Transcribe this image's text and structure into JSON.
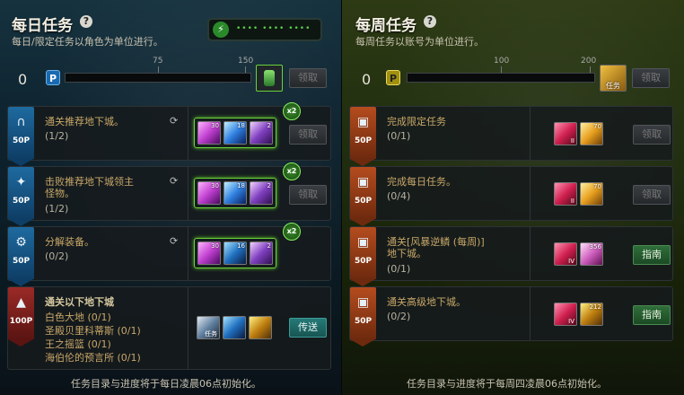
{
  "daily": {
    "title": "每日任务",
    "help": "?",
    "subtitle": "每日/限定任务以角色为单位进行。",
    "points": "0",
    "point_badge": "P",
    "ticks": [
      "75",
      "150"
    ],
    "progress": 0,
    "claim_label": "领取",
    "footer": "任务目录与进度将于每日凌晨06点初始化。",
    "battery_dots": "•••• •••• ••••",
    "tasks": [
      {
        "name": "通关推荐地下城。",
        "progress": "(1/2)",
        "points": "50P",
        "icon": "∩",
        "button": "领取",
        "items": [
          "30",
          "18",
          "2"
        ],
        "bonus": "x2"
      },
      {
        "name": "击败推荐地下城领主怪物。",
        "progress": "(1/2)",
        "points": "50P",
        "icon": "✦",
        "button": "领取",
        "items": [
          "30",
          "18",
          "2"
        ],
        "bonus": "x2"
      },
      {
        "name": "分解装备。",
        "progress": "(0/2)",
        "points": "50P",
        "icon": "⚙",
        "button": "领取",
        "items": [
          "30",
          "16",
          "2"
        ],
        "bonus": "x2"
      },
      {
        "name": "通关以下地下城",
        "subs": [
          "白色大地 (0/1)",
          "圣殿贝里科蒂斯 (0/1)",
          "王之摇篮 (0/1)",
          "海伯伦的预言所 (0/1)"
        ],
        "points": "100P",
        "icon": "▲",
        "button": "传送",
        "item_label": "任务"
      }
    ]
  },
  "weekly": {
    "title": "每周任务",
    "help": "?",
    "subtitle": "每周任务以账号为单位进行。",
    "points": "0",
    "point_badge": "P",
    "ticks": [
      "100",
      "200"
    ],
    "progress": 0,
    "claim_label": "领取",
    "reward_label": "任务",
    "footer": "任务目录与进度将于每周四凌晨06点初始化。",
    "tasks": [
      {
        "name": "完成限定任务",
        "progress": "(0/1)",
        "points": "50P",
        "button": "领取",
        "items": [
          "II",
          "70"
        ]
      },
      {
        "name": "完成每日任务。",
        "progress": "(0/4)",
        "points": "50P",
        "button": "领取",
        "items": [
          "II",
          "70"
        ]
      },
      {
        "name": "通关[风暴逆鳞 (每周)]地下城。",
        "progress": "(0/1)",
        "points": "50P",
        "button": "指南",
        "items": [
          "IV",
          "356"
        ]
      },
      {
        "name": "通关高级地下城。",
        "progress": "(0/2)",
        "points": "50P",
        "button": "指南",
        "items": [
          "IV",
          "212"
        ]
      }
    ]
  },
  "colors": {
    "daily_ribbon": "#1e6aa0",
    "special_ribbon": "#9a2a26",
    "weekly_ribbon": "#b44c1e",
    "bonus_glow": "#6ad23a"
  }
}
